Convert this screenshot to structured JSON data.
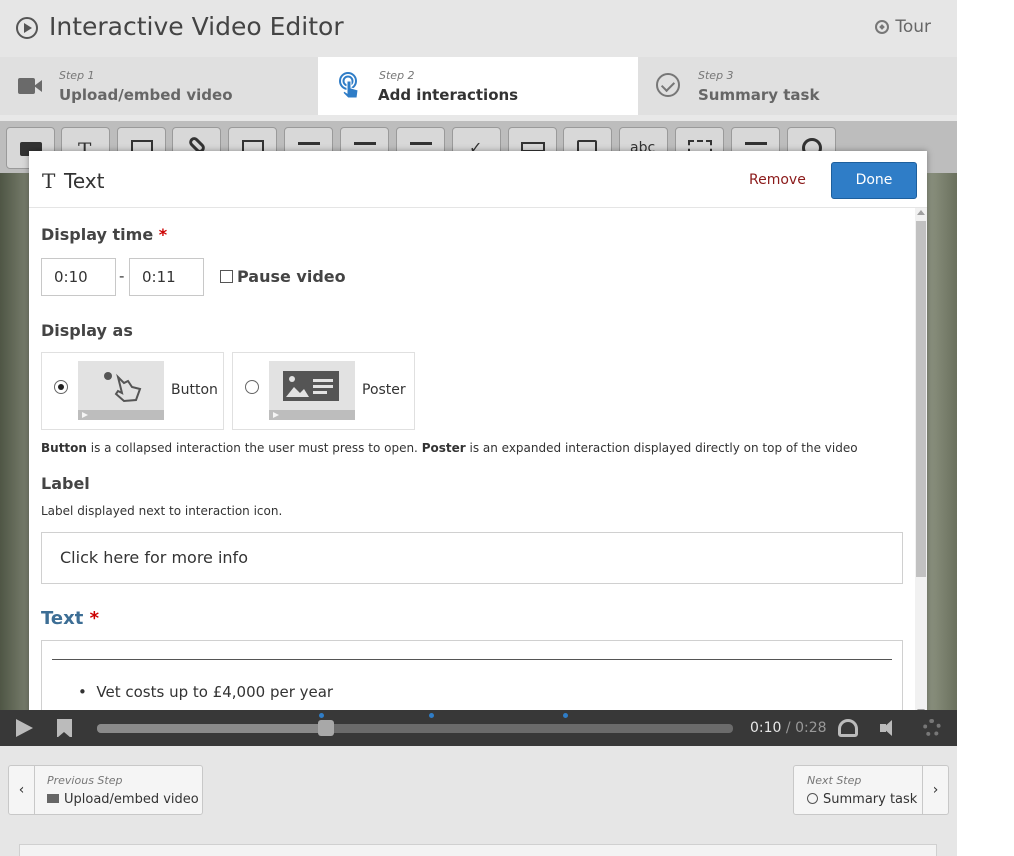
{
  "header": {
    "title": "Interactive Video Editor",
    "tour_label": "Tour"
  },
  "steps": [
    {
      "num": "Step 1",
      "name": "Upload/embed video"
    },
    {
      "num": "Step 2",
      "name": "Add interactions"
    },
    {
      "num": "Step 3",
      "name": "Summary task"
    }
  ],
  "toolbar": {
    "buttons": [
      "label-icon",
      "text-icon",
      "table-icon",
      "link-icon",
      "image-icon",
      "statements-icon",
      "single-choice-icon",
      "multiple-choice-icon",
      "true-false-icon",
      "fill-blanks-icon",
      "drag-drop-icon",
      "mark-words-icon",
      "drag-text-icon",
      "crossroads-icon",
      "navigation-hotspot-icon"
    ]
  },
  "dialog": {
    "title": "Text",
    "remove_label": "Remove",
    "done_label": "Done",
    "display_time_label": "Display time",
    "required_mark": "*",
    "time_from": "0:10",
    "time_sep": "-",
    "time_to": "0:11",
    "pause_label": "Pause video",
    "display_as_label": "Display as",
    "option_button": "Button",
    "option_poster": "Poster",
    "selected_option": "Button",
    "help_bold_button": "Button",
    "help_mid": " is a collapsed interaction the user must press to open. ",
    "help_bold_poster": "Poster",
    "help_end": " is an expanded interaction displayed directly on top of the video",
    "label_label": "Label",
    "label_help": "Label displayed next to interaction icon.",
    "label_value": "Click here for more info",
    "text_label": "Text",
    "text_bullet_1": "Vet costs up to £4,000 per year"
  },
  "player": {
    "current_time": "0:10",
    "time_sep": " / ",
    "total_time": "0:28",
    "progress": 0.36
  },
  "footer": {
    "prev_small": "Previous Step",
    "prev_big": "Upload/embed video",
    "next_small": "Next Step",
    "next_big": "Summary task"
  },
  "colors": {
    "accent": "#2f7dc7",
    "remove": "#8b1a1a",
    "required": "#cc0000",
    "text_field_label": "#3d6e95"
  }
}
